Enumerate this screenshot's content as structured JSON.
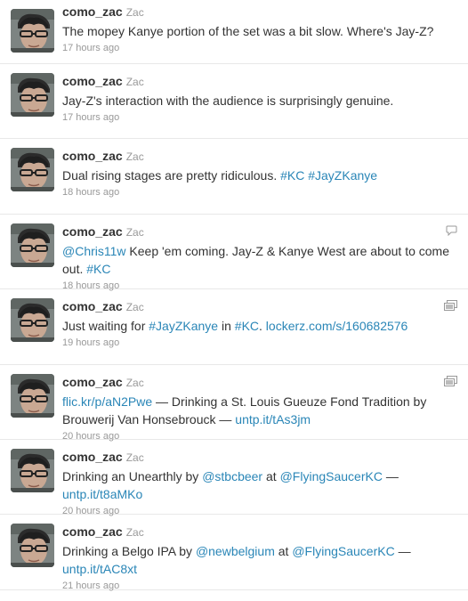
{
  "colors": {
    "link": "#2a86b7",
    "text": "#333333",
    "meta": "#999999"
  },
  "tweets": [
    {
      "screen_name": "como_zac",
      "full_name": "Zac",
      "parts": [
        {
          "t": "text",
          "v": "The mopey Kanye portion of the set was a bit slow. Where's Jay-Z?"
        }
      ],
      "time": "17 hours ago",
      "icon": ""
    },
    {
      "screen_name": "como_zac",
      "full_name": "Zac",
      "parts": [
        {
          "t": "text",
          "v": "Jay-Z's interaction with the audience is surprisingly genuine."
        }
      ],
      "time": "17 hours ago",
      "icon": ""
    },
    {
      "screen_name": "como_zac",
      "full_name": "Zac",
      "parts": [
        {
          "t": "text",
          "v": "Dual rising stages are pretty ridiculous. "
        },
        {
          "t": "link",
          "v": "#KC"
        },
        {
          "t": "text",
          "v": " "
        },
        {
          "t": "link",
          "v": "#JayZKanye"
        }
      ],
      "time": "18 hours ago",
      "icon": ""
    },
    {
      "screen_name": "como_zac",
      "full_name": "Zac",
      "parts": [
        {
          "t": "link",
          "v": "@Chris11w"
        },
        {
          "t": "text",
          "v": " Keep 'em coming. Jay-Z & Kanye West are about to come out. "
        },
        {
          "t": "link",
          "v": "#KC"
        }
      ],
      "time": "18 hours ago",
      "icon": "reply-icon"
    },
    {
      "screen_name": "como_zac",
      "full_name": "Zac",
      "parts": [
        {
          "t": "text",
          "v": "Just waiting for "
        },
        {
          "t": "link",
          "v": "#JayZKanye"
        },
        {
          "t": "text",
          "v": " in "
        },
        {
          "t": "link",
          "v": "#KC"
        },
        {
          "t": "text",
          "v": ". "
        },
        {
          "t": "link",
          "v": "lockerz.com/s/160682576"
        }
      ],
      "time": "19 hours ago",
      "icon": "media-icon"
    },
    {
      "screen_name": "como_zac",
      "full_name": "Zac",
      "parts": [
        {
          "t": "link",
          "v": "flic.kr/p/aN2Pwe"
        },
        {
          "t": "text",
          "v": " — Drinking a St. Louis Gueuze Fond Tradition by Brouwerij Van Honsebrouck — "
        },
        {
          "t": "link",
          "v": "untp.it/tAs3jm"
        }
      ],
      "time": "20 hours ago",
      "icon": "media-icon"
    },
    {
      "screen_name": "como_zac",
      "full_name": "Zac",
      "parts": [
        {
          "t": "text",
          "v": "Drinking an Unearthly by "
        },
        {
          "t": "link",
          "v": "@stbcbeer"
        },
        {
          "t": "text",
          "v": " at "
        },
        {
          "t": "link",
          "v": "@FlyingSaucerKC"
        },
        {
          "t": "text",
          "v": " — "
        },
        {
          "t": "link",
          "v": "untp.it/t8aMKo"
        }
      ],
      "time": "20 hours ago",
      "icon": ""
    },
    {
      "screen_name": "como_zac",
      "full_name": "Zac",
      "parts": [
        {
          "t": "text",
          "v": "Drinking a Belgo IPA by "
        },
        {
          "t": "link",
          "v": "@newbelgium"
        },
        {
          "t": "text",
          "v": " at "
        },
        {
          "t": "link",
          "v": "@FlyingSaucerKC"
        },
        {
          "t": "text",
          "v": " — "
        },
        {
          "t": "link",
          "v": "untp.it/tAC8xt"
        }
      ],
      "time": "21 hours ago",
      "icon": ""
    }
  ]
}
